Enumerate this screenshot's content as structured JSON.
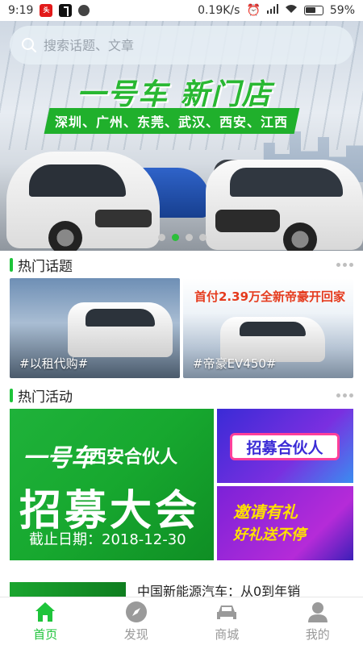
{
  "status_bar": {
    "time": "9:19",
    "speed": "0.19K/s",
    "battery": "59%"
  },
  "search": {
    "placeholder": "搜索话题、文章"
  },
  "banner": {
    "title": "一号车 新门店",
    "cities": "深圳、广州、东莞、武汉、西安、江西",
    "dots_count": 4,
    "active_dot": 1
  },
  "hot_topics": {
    "title": "热门话题",
    "items": [
      {
        "tag": "#以租代购#"
      },
      {
        "promo": "首付2.39万全新帝豪开回家",
        "tag": "#帝豪EV450#"
      }
    ]
  },
  "hot_events": {
    "title": "热门活动",
    "main": {
      "logo": "一号车",
      "subtitle": "西安合伙人",
      "headline": "招募大会",
      "deadline": "截止日期：2018-12-30"
    },
    "side": [
      {
        "label": "招募合伙人"
      },
      {
        "line1": "邀请有礼",
        "line2": "好礼送不停"
      }
    ]
  },
  "news": {
    "title": "中国新能源汽车：从0到年销"
  },
  "tabs": [
    {
      "label": "首页",
      "icon": "home-icon",
      "active": true
    },
    {
      "label": "发现",
      "icon": "compass-icon",
      "active": false
    },
    {
      "label": "商城",
      "icon": "car-icon",
      "active": false
    },
    {
      "label": "我的",
      "icon": "person-icon",
      "active": false
    }
  ],
  "colors": {
    "accent": "#1ec43a",
    "inactive": "#999999"
  }
}
